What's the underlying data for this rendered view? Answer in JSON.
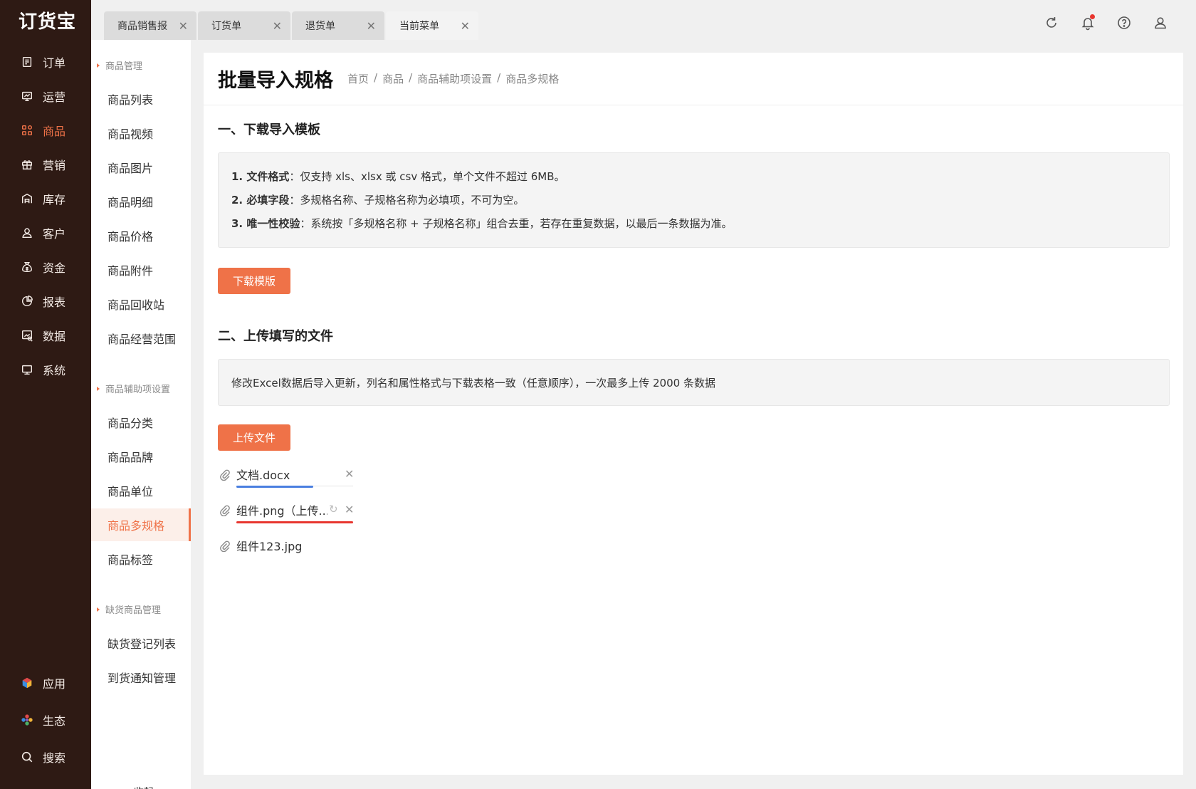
{
  "app": {
    "logo": "订货宝"
  },
  "nav": {
    "items": [
      {
        "label": "订单",
        "icon": "order-icon"
      },
      {
        "label": "运营",
        "icon": "operation-icon"
      },
      {
        "label": "商品",
        "icon": "goods-icon",
        "active": true
      },
      {
        "label": "营销",
        "icon": "gift-icon"
      },
      {
        "label": "库存",
        "icon": "warehouse-icon"
      },
      {
        "label": "客户",
        "icon": "user-icon"
      },
      {
        "label": "资金",
        "icon": "money-bag-icon"
      },
      {
        "label": "报表",
        "icon": "pie-chart-icon"
      },
      {
        "label": "数据",
        "icon": "data-icon"
      },
      {
        "label": "系统",
        "icon": "monitor-icon"
      }
    ],
    "bottom": [
      {
        "label": "应用",
        "icon": "cube-icon"
      },
      {
        "label": "生态",
        "icon": "flower-icon"
      },
      {
        "label": "搜索",
        "icon": "search-icon"
      }
    ]
  },
  "submenu": {
    "group1": "商品管理",
    "items1": [
      "商品列表",
      "商品视频",
      "商品图片",
      "商品明细",
      "商品价格",
      "商品附件",
      "商品回收站",
      "商品经营范围"
    ],
    "group2": "商品辅助项设置",
    "items2": [
      "商品分类",
      "商品品牌",
      "商品单位",
      "商品多规格",
      "商品标签"
    ],
    "active": "商品多规格",
    "group3": "缺货商品管理",
    "items3": [
      "缺货登记列表",
      "到货通知管理"
    ],
    "collapse": "收起"
  },
  "tabs": [
    {
      "label": "商品销售报",
      "active": false
    },
    {
      "label": "订货单",
      "active": false
    },
    {
      "label": "退货单",
      "active": false
    },
    {
      "label": "当前菜单",
      "active": true
    }
  ],
  "topbar": {
    "icons": [
      "refresh-icon",
      "bell-icon",
      "help-icon",
      "account-icon"
    ],
    "accent": "#ef7248"
  },
  "page": {
    "title": "批量导入规格",
    "breadcrumb": [
      "首页",
      "商品",
      "商品辅助项设置",
      "商品多规格"
    ],
    "section1": {
      "title": "一、下载导入模板",
      "rules": [
        {
          "bold": "1. 文件格式",
          "text": "：仅支持 xls、xlsx 或 csv 格式，单个文件不超过 6MB。"
        },
        {
          "bold": "2. 必填字段",
          "text": "：多规格名称、子规格名称为必填项，不可为空。"
        },
        {
          "bold": "3. 唯一性校验",
          "text": "：系统按「多规格名称 + 子规格名称」组合去重，若存在重复数据，以最后一条数据为准。"
        }
      ],
      "button": "下载模版"
    },
    "section2": {
      "title": "二、上传填写的文件",
      "note": "修改Excel数据后导入更新，列名和属性格式与下载表格一致（任意顺序），一次最多上传 2000 条数据",
      "button": "上传文件"
    },
    "files": [
      {
        "name": "文档.docx",
        "status": "success",
        "progress": 0.66,
        "color": "#4a7fe0"
      },
      {
        "name": "组件.png（上传...",
        "status": "uploading",
        "progress": 1.0,
        "color": "#e8362f"
      },
      {
        "name": "组件123.jpg",
        "status": "done"
      }
    ]
  }
}
